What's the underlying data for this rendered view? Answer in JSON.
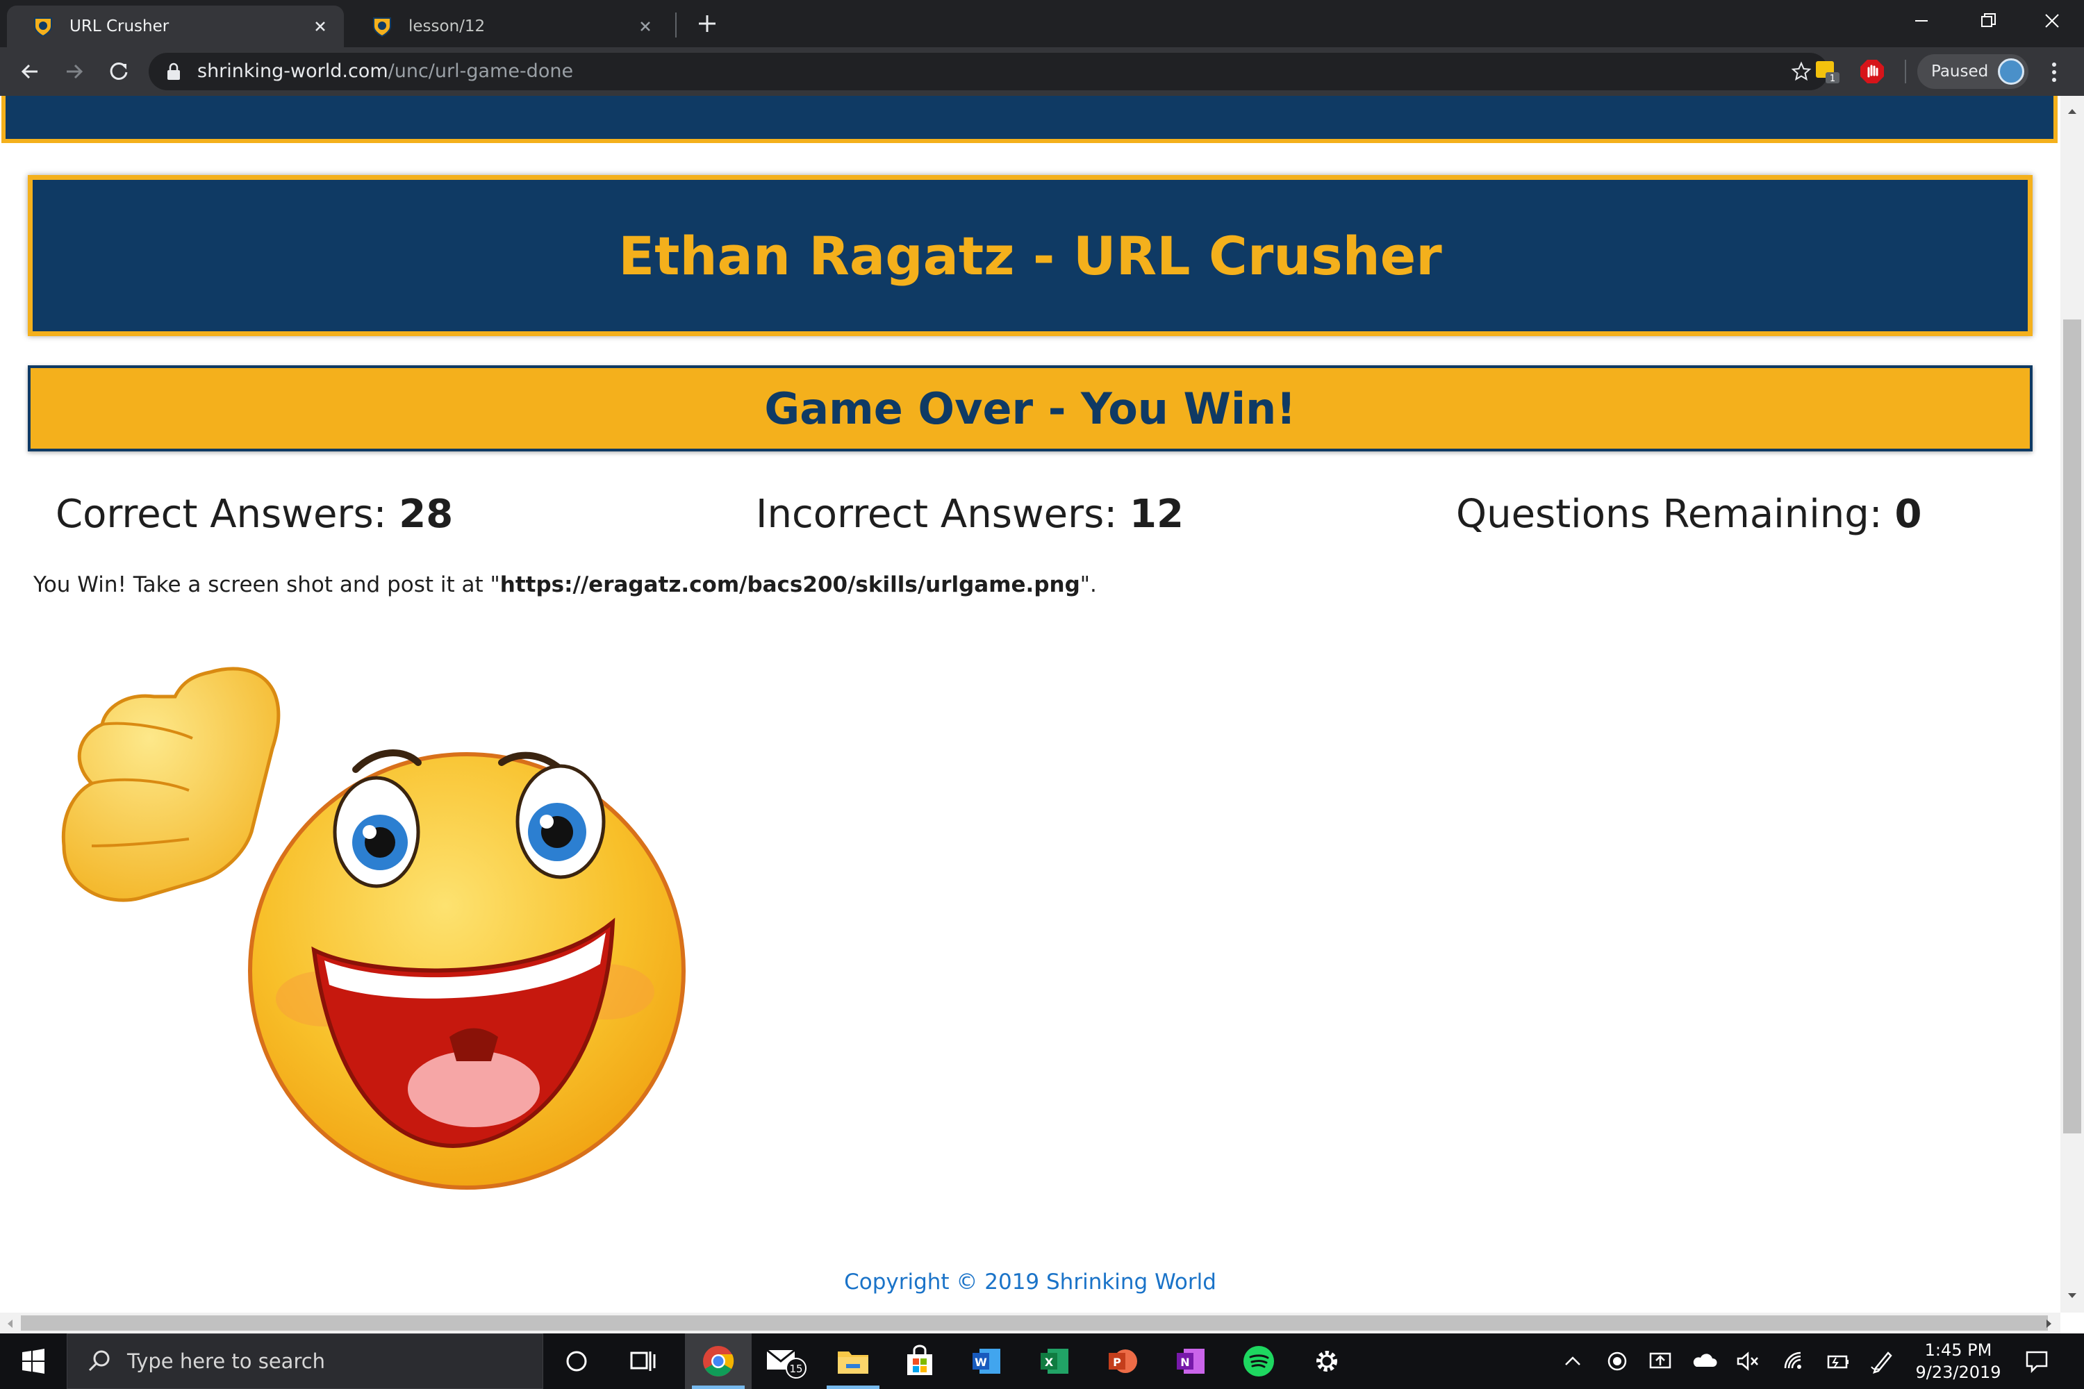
{
  "browser": {
    "tabs": [
      {
        "title": "URL Crusher",
        "active": true,
        "favicon": "unc-shield-icon"
      },
      {
        "title": "lesson/12",
        "active": false,
        "favicon": "unc-shield-icon"
      }
    ],
    "url_host": "shrinking-world.com",
    "url_path": "/unc/url-game-done",
    "profile_label": "Paused",
    "extension_badge": "1"
  },
  "page": {
    "title": "Ethan Ragatz - URL Crusher",
    "result_heading": "Game Over - You Win!",
    "stats": {
      "correct_label": "Correct Answers: ",
      "correct_value": "28",
      "incorrect_label": "Incorrect Answers: ",
      "incorrect_value": "12",
      "remaining_label": "Questions Remaining: ",
      "remaining_value": "0"
    },
    "message_prefix": "You Win! Take a screen shot and post it at \"",
    "message_url": "https://eragatz.com/bacs200/skills/urlgame.png",
    "message_suffix": "\".",
    "image": "thumbs-up-smiley",
    "copyright": "Copyright © 2019 Shrinking World"
  },
  "taskbar": {
    "search_placeholder": "Type here to search",
    "mail_badge": "15",
    "time": "1:45 PM",
    "date": "9/23/2019"
  },
  "colors": {
    "navy": "#0f3a64",
    "gold": "#f4b01c",
    "link": "#1a73c8"
  }
}
